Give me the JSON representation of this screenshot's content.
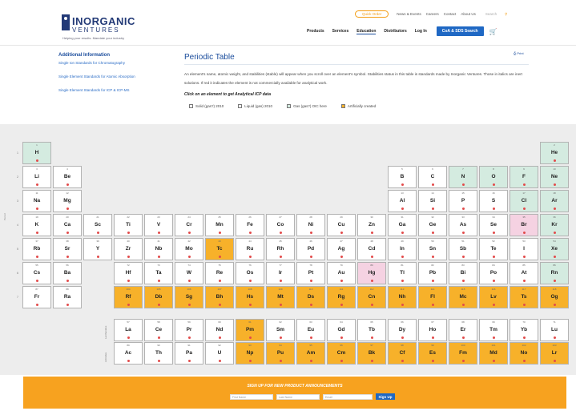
{
  "header": {
    "logo_word": "INORGANIC",
    "logo_sub": "VENTURES",
    "logo_tagline": "Helping your results. Mandate your industry",
    "utility_links": [
      "Quick Order",
      "News & Events",
      "Careers",
      "Contact",
      "About Us"
    ],
    "search_label": "Search",
    "nav_links": [
      "Products",
      "Services",
      "Education",
      "Distributors",
      "Log In"
    ],
    "coa_button": "CoA & SDS Search"
  },
  "sidebar": {
    "title": "Additional Information",
    "links": [
      "Single Ion Standards for Chromatography",
      "Single Element Standards for Atomic Absorption",
      "Single Element Standards for ICP & ICP-MS"
    ]
  },
  "content": {
    "title": "Periodic Table",
    "print_link": "Print",
    "intro": "An element's name, atomic weight, and stabilities (stable) will appear when you scroll over an element's symbol. Stabilities status in this table is standards made by Inorganic Ventures. Those in italics are inert solutions. If red it indicates the element is not commercially available for analytical work.",
    "prompt": "Click on an element to get Analytical ICP data",
    "legend": [
      {
        "label": "Solid (gas?) 2010",
        "color": "#ffffff"
      },
      {
        "label": "Liquid (gas) 2010",
        "color": "#ffffff"
      },
      {
        "label": "Gas (gas?) OIC here",
        "color": "#d4ebe0"
      },
      {
        "label": "Artificially created",
        "color": "#f7b12a"
      }
    ]
  },
  "table": {
    "period_axis_label": "Period",
    "lanthanide_label": "Lanthanides",
    "actinide_label": "Actinides",
    "elements": [
      {
        "n": "1",
        "s": "H",
        "c": "green",
        "g": 1,
        "p": 1
      },
      {
        "n": "2",
        "s": "He",
        "c": "green",
        "g": 18,
        "p": 1
      },
      {
        "n": "3",
        "s": "Li",
        "c": "white",
        "g": 1,
        "p": 2
      },
      {
        "n": "4",
        "s": "Be",
        "c": "white",
        "g": 2,
        "p": 2
      },
      {
        "n": "5",
        "s": "B",
        "c": "white",
        "g": 13,
        "p": 2
      },
      {
        "n": "6",
        "s": "C",
        "c": "white",
        "g": 14,
        "p": 2
      },
      {
        "n": "7",
        "s": "N",
        "c": "green",
        "g": 15,
        "p": 2
      },
      {
        "n": "8",
        "s": "O",
        "c": "green",
        "g": 16,
        "p": 2
      },
      {
        "n": "9",
        "s": "F",
        "c": "green",
        "g": 17,
        "p": 2
      },
      {
        "n": "10",
        "s": "Ne",
        "c": "green",
        "g": 18,
        "p": 2
      },
      {
        "n": "11",
        "s": "Na",
        "c": "white",
        "g": 1,
        "p": 3
      },
      {
        "n": "12",
        "s": "Mg",
        "c": "white",
        "g": 2,
        "p": 3
      },
      {
        "n": "13",
        "s": "Al",
        "c": "white",
        "g": 13,
        "p": 3
      },
      {
        "n": "14",
        "s": "Si",
        "c": "white",
        "g": 14,
        "p": 3
      },
      {
        "n": "15",
        "s": "P",
        "c": "white",
        "g": 15,
        "p": 3
      },
      {
        "n": "16",
        "s": "S",
        "c": "white",
        "g": 16,
        "p": 3
      },
      {
        "n": "17",
        "s": "Cl",
        "c": "green",
        "g": 17,
        "p": 3
      },
      {
        "n": "18",
        "s": "Ar",
        "c": "green",
        "g": 18,
        "p": 3
      },
      {
        "n": "19",
        "s": "K",
        "c": "white",
        "g": 1,
        "p": 4
      },
      {
        "n": "20",
        "s": "Ca",
        "c": "white",
        "g": 2,
        "p": 4
      },
      {
        "n": "21",
        "s": "Sc",
        "c": "white",
        "g": 3,
        "p": 4
      },
      {
        "n": "22",
        "s": "Ti",
        "c": "white",
        "g": 4,
        "p": 4
      },
      {
        "n": "23",
        "s": "V",
        "c": "white",
        "g": 5,
        "p": 4
      },
      {
        "n": "24",
        "s": "Cr",
        "c": "white",
        "g": 6,
        "p": 4
      },
      {
        "n": "25",
        "s": "Mn",
        "c": "white",
        "g": 7,
        "p": 4
      },
      {
        "n": "26",
        "s": "Fe",
        "c": "white",
        "g": 8,
        "p": 4
      },
      {
        "n": "27",
        "s": "Co",
        "c": "white",
        "g": 9,
        "p": 4
      },
      {
        "n": "28",
        "s": "Ni",
        "c": "white",
        "g": 10,
        "p": 4
      },
      {
        "n": "29",
        "s": "Cu",
        "c": "white",
        "g": 11,
        "p": 4
      },
      {
        "n": "30",
        "s": "Zn",
        "c": "white",
        "g": 12,
        "p": 4
      },
      {
        "n": "31",
        "s": "Ga",
        "c": "white",
        "g": 13,
        "p": 4
      },
      {
        "n": "32",
        "s": "Ge",
        "c": "white",
        "g": 14,
        "p": 4
      },
      {
        "n": "33",
        "s": "As",
        "c": "white",
        "g": 15,
        "p": 4
      },
      {
        "n": "34",
        "s": "Se",
        "c": "white",
        "g": 16,
        "p": 4
      },
      {
        "n": "35",
        "s": "Br",
        "c": "pink",
        "g": 17,
        "p": 4
      },
      {
        "n": "36",
        "s": "Kr",
        "c": "green",
        "g": 18,
        "p": 4
      },
      {
        "n": "37",
        "s": "Rb",
        "c": "white",
        "g": 1,
        "p": 5
      },
      {
        "n": "38",
        "s": "Sr",
        "c": "white",
        "g": 2,
        "p": 5
      },
      {
        "n": "39",
        "s": "Y",
        "c": "white",
        "g": 3,
        "p": 5
      },
      {
        "n": "40",
        "s": "Zr",
        "c": "white",
        "g": 4,
        "p": 5
      },
      {
        "n": "41",
        "s": "Nb",
        "c": "white",
        "g": 5,
        "p": 5
      },
      {
        "n": "42",
        "s": "Mo",
        "c": "white",
        "g": 6,
        "p": 5
      },
      {
        "n": "43",
        "s": "Tc",
        "c": "orange",
        "g": 7,
        "p": 5
      },
      {
        "n": "44",
        "s": "Ru",
        "c": "white",
        "g": 8,
        "p": 5
      },
      {
        "n": "45",
        "s": "Rh",
        "c": "white",
        "g": 9,
        "p": 5
      },
      {
        "n": "46",
        "s": "Pd",
        "c": "white",
        "g": 10,
        "p": 5
      },
      {
        "n": "47",
        "s": "Ag",
        "c": "white",
        "g": 11,
        "p": 5
      },
      {
        "n": "48",
        "s": "Cd",
        "c": "white",
        "g": 12,
        "p": 5
      },
      {
        "n": "49",
        "s": "In",
        "c": "white",
        "g": 13,
        "p": 5
      },
      {
        "n": "50",
        "s": "Sn",
        "c": "white",
        "g": 14,
        "p": 5
      },
      {
        "n": "51",
        "s": "Sb",
        "c": "white",
        "g": 15,
        "p": 5
      },
      {
        "n": "52",
        "s": "Te",
        "c": "white",
        "g": 16,
        "p": 5
      },
      {
        "n": "53",
        "s": "I",
        "c": "white",
        "g": 17,
        "p": 5
      },
      {
        "n": "54",
        "s": "Xe",
        "c": "green",
        "g": 18,
        "p": 5
      },
      {
        "n": "55",
        "s": "Cs",
        "c": "white",
        "g": 1,
        "p": 6
      },
      {
        "n": "56",
        "s": "Ba",
        "c": "white",
        "g": 2,
        "p": 6
      },
      {
        "n": "72",
        "s": "Hf",
        "c": "white",
        "g": 4,
        "p": 6
      },
      {
        "n": "73",
        "s": "Ta",
        "c": "white",
        "g": 5,
        "p": 6
      },
      {
        "n": "74",
        "s": "W",
        "c": "white",
        "g": 6,
        "p": 6
      },
      {
        "n": "75",
        "s": "Re",
        "c": "white",
        "g": 7,
        "p": 6
      },
      {
        "n": "76",
        "s": "Os",
        "c": "white",
        "g": 8,
        "p": 6
      },
      {
        "n": "77",
        "s": "Ir",
        "c": "white",
        "g": 9,
        "p": 6
      },
      {
        "n": "78",
        "s": "Pt",
        "c": "white",
        "g": 10,
        "p": 6
      },
      {
        "n": "79",
        "s": "Au",
        "c": "white",
        "g": 11,
        "p": 6
      },
      {
        "n": "80",
        "s": "Hg",
        "c": "pink",
        "g": 12,
        "p": 6
      },
      {
        "n": "81",
        "s": "Tl",
        "c": "white",
        "g": 13,
        "p": 6
      },
      {
        "n": "82",
        "s": "Pb",
        "c": "white",
        "g": 14,
        "p": 6
      },
      {
        "n": "83",
        "s": "Bi",
        "c": "white",
        "g": 15,
        "p": 6
      },
      {
        "n": "84",
        "s": "Po",
        "c": "white",
        "g": 16,
        "p": 6
      },
      {
        "n": "85",
        "s": "At",
        "c": "white",
        "g": 17,
        "p": 6
      },
      {
        "n": "86",
        "s": "Rn",
        "c": "green",
        "g": 18,
        "p": 6
      },
      {
        "n": "87",
        "s": "Fr",
        "c": "white",
        "g": 1,
        "p": 7
      },
      {
        "n": "88",
        "s": "Ra",
        "c": "white",
        "g": 2,
        "p": 7
      },
      {
        "n": "104",
        "s": "Rf",
        "c": "orange",
        "g": 4,
        "p": 7
      },
      {
        "n": "105",
        "s": "Db",
        "c": "orange",
        "g": 5,
        "p": 7
      },
      {
        "n": "106",
        "s": "Sg",
        "c": "orange",
        "g": 6,
        "p": 7
      },
      {
        "n": "107",
        "s": "Bh",
        "c": "orange",
        "g": 7,
        "p": 7
      },
      {
        "n": "108",
        "s": "Hs",
        "c": "orange",
        "g": 8,
        "p": 7
      },
      {
        "n": "109",
        "s": "Mt",
        "c": "orange",
        "g": 9,
        "p": 7
      },
      {
        "n": "110",
        "s": "Ds",
        "c": "orange",
        "g": 10,
        "p": 7
      },
      {
        "n": "111",
        "s": "Rg",
        "c": "orange",
        "g": 11,
        "p": 7
      },
      {
        "n": "112",
        "s": "Cn",
        "c": "orange",
        "g": 12,
        "p": 7
      },
      {
        "n": "113",
        "s": "Nh",
        "c": "orange",
        "g": 13,
        "p": 7
      },
      {
        "n": "114",
        "s": "Fl",
        "c": "orange",
        "g": 14,
        "p": 7
      },
      {
        "n": "115",
        "s": "Mc",
        "c": "orange",
        "g": 15,
        "p": 7
      },
      {
        "n": "116",
        "s": "Lv",
        "c": "orange",
        "g": 16,
        "p": 7
      },
      {
        "n": "117",
        "s": "Ts",
        "c": "orange",
        "g": 17,
        "p": 7
      },
      {
        "n": "118",
        "s": "Og",
        "c": "orange",
        "g": 18,
        "p": 7
      },
      {
        "n": "57",
        "s": "La",
        "c": "white",
        "g": 4,
        "p": 9
      },
      {
        "n": "58",
        "s": "Ce",
        "c": "white",
        "g": 5,
        "p": 9
      },
      {
        "n": "59",
        "s": "Pr",
        "c": "white",
        "g": 6,
        "p": 9
      },
      {
        "n": "60",
        "s": "Nd",
        "c": "white",
        "g": 7,
        "p": 9
      },
      {
        "n": "61",
        "s": "Pm",
        "c": "orange",
        "g": 8,
        "p": 9
      },
      {
        "n": "62",
        "s": "Sm",
        "c": "white",
        "g": 9,
        "p": 9
      },
      {
        "n": "63",
        "s": "Eu",
        "c": "white",
        "g": 10,
        "p": 9
      },
      {
        "n": "64",
        "s": "Gd",
        "c": "white",
        "g": 11,
        "p": 9
      },
      {
        "n": "65",
        "s": "Tb",
        "c": "white",
        "g": 12,
        "p": 9
      },
      {
        "n": "66",
        "s": "Dy",
        "c": "white",
        "g": 13,
        "p": 9
      },
      {
        "n": "67",
        "s": "Ho",
        "c": "white",
        "g": 14,
        "p": 9
      },
      {
        "n": "68",
        "s": "Er",
        "c": "white",
        "g": 15,
        "p": 9
      },
      {
        "n": "69",
        "s": "Tm",
        "c": "white",
        "g": 16,
        "p": 9
      },
      {
        "n": "70",
        "s": "Yb",
        "c": "white",
        "g": 17,
        "p": 9
      },
      {
        "n": "71",
        "s": "Lu",
        "c": "white",
        "g": 18,
        "p": 9
      },
      {
        "n": "89",
        "s": "Ac",
        "c": "white",
        "g": 4,
        "p": 10
      },
      {
        "n": "90",
        "s": "Th",
        "c": "white",
        "g": 5,
        "p": 10
      },
      {
        "n": "91",
        "s": "Pa",
        "c": "white",
        "g": 6,
        "p": 10
      },
      {
        "n": "92",
        "s": "U",
        "c": "white",
        "g": 7,
        "p": 10
      },
      {
        "n": "93",
        "s": "Np",
        "c": "orange",
        "g": 8,
        "p": 10
      },
      {
        "n": "94",
        "s": "Pu",
        "c": "orange",
        "g": 9,
        "p": 10
      },
      {
        "n": "95",
        "s": "Am",
        "c": "orange",
        "g": 10,
        "p": 10
      },
      {
        "n": "96",
        "s": "Cm",
        "c": "orange",
        "g": 11,
        "p": 10
      },
      {
        "n": "97",
        "s": "Bk",
        "c": "orange",
        "g": 12,
        "p": 10
      },
      {
        "n": "98",
        "s": "Cf",
        "c": "orange",
        "g": 13,
        "p": 10
      },
      {
        "n": "99",
        "s": "Es",
        "c": "orange",
        "g": 14,
        "p": 10
      },
      {
        "n": "100",
        "s": "Fm",
        "c": "orange",
        "g": 15,
        "p": 10
      },
      {
        "n": "101",
        "s": "Md",
        "c": "orange",
        "g": 16,
        "p": 10
      },
      {
        "n": "102",
        "s": "No",
        "c": "orange",
        "g": 17,
        "p": 10
      },
      {
        "n": "103",
        "s": "Lr",
        "c": "orange",
        "g": 18,
        "p": 10
      }
    ]
  },
  "signup": {
    "title": "SIGN UP FOR NEW PRODUCT ANNOUNCEMENTS",
    "first_name_placeholder": "First Name",
    "last_name_placeholder": "Last Name",
    "email_placeholder": "Email",
    "button": "Sign Up"
  },
  "colors": {
    "brand_blue": "#1a4c9c",
    "button_blue": "#1f68c4",
    "orange": "#f7a21f",
    "green_cell": "#d4ebe0",
    "pink_cell": "#f5d2e2"
  }
}
